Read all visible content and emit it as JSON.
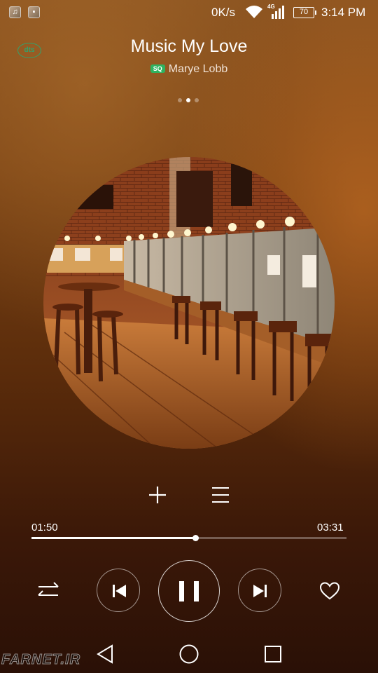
{
  "status_bar": {
    "net_speed": "0K/s",
    "network_type": "4G",
    "battery": "70",
    "time": "3:14 PM",
    "icons": [
      "music-notification-icon",
      "gallery-notification-icon",
      "wifi-icon",
      "signal-icon",
      "battery-icon"
    ]
  },
  "header": {
    "dts_badge": "dts",
    "title": "Music My Love",
    "quality_badge": "SQ",
    "artist": "Marye Lobb",
    "page_indicator": {
      "count": 3,
      "active": 2
    }
  },
  "actions": {
    "icons": [
      "add-icon",
      "queue-icon"
    ]
  },
  "playback": {
    "elapsed": "01:50",
    "total": "03:31",
    "progress_fraction": 0.521
  },
  "controls": {
    "icons": [
      "shuffle-icon",
      "previous-icon",
      "pause-icon",
      "next-icon",
      "heart-icon"
    ]
  },
  "nav_bar": {
    "icons": [
      "back-icon",
      "home-icon",
      "recents-icon"
    ]
  },
  "watermark": "FARNET.IR",
  "colors": {
    "accent_green": "#2fb35f",
    "background_top": "#8a5320",
    "background_bottom": "#2a1006"
  }
}
